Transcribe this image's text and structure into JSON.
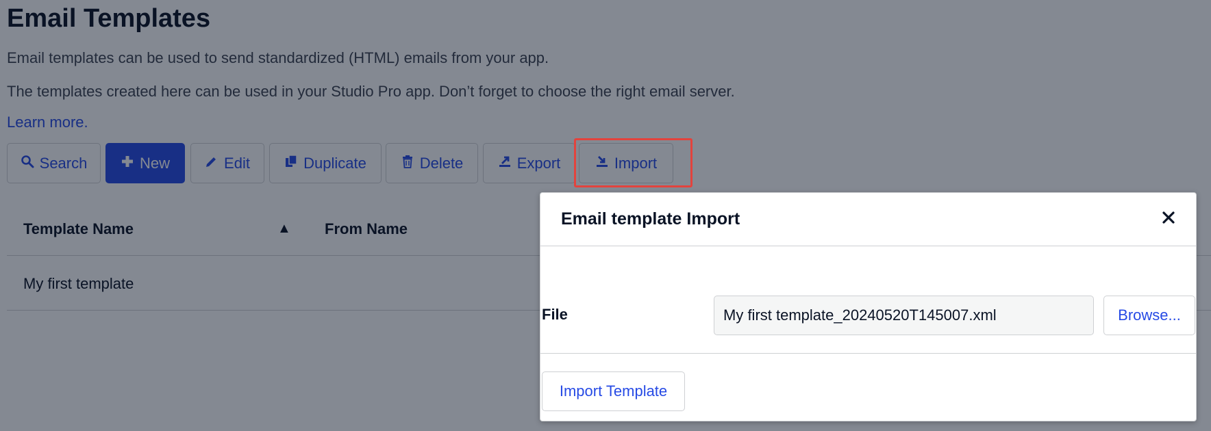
{
  "page": {
    "title": "Email Templates",
    "description_1": "Email templates can be used to send standardized (HTML) emails from your app.",
    "description_2": "The templates created here can be used in your Studio Pro app. Don’t forget to choose the right email server.",
    "learn_more": "Learn more."
  },
  "toolbar": {
    "search": "Search",
    "new": "New",
    "edit": "Edit",
    "duplicate": "Duplicate",
    "delete": "Delete",
    "export": "Export",
    "import": "Import"
  },
  "table": {
    "columns": [
      "Template Name",
      "From Name"
    ],
    "sort_indicator": "▲",
    "rows": [
      [
        "My first template"
      ]
    ]
  },
  "modal": {
    "title": "Email template Import",
    "file_label": "File",
    "file_value": "My first template_20240520T145007.xml",
    "browse": "Browse...",
    "import_button": "Import Template"
  },
  "colors": {
    "accent": "#264ae5",
    "highlight": "#e3433d",
    "overlay": "rgba(10,19,37,0.5)"
  }
}
